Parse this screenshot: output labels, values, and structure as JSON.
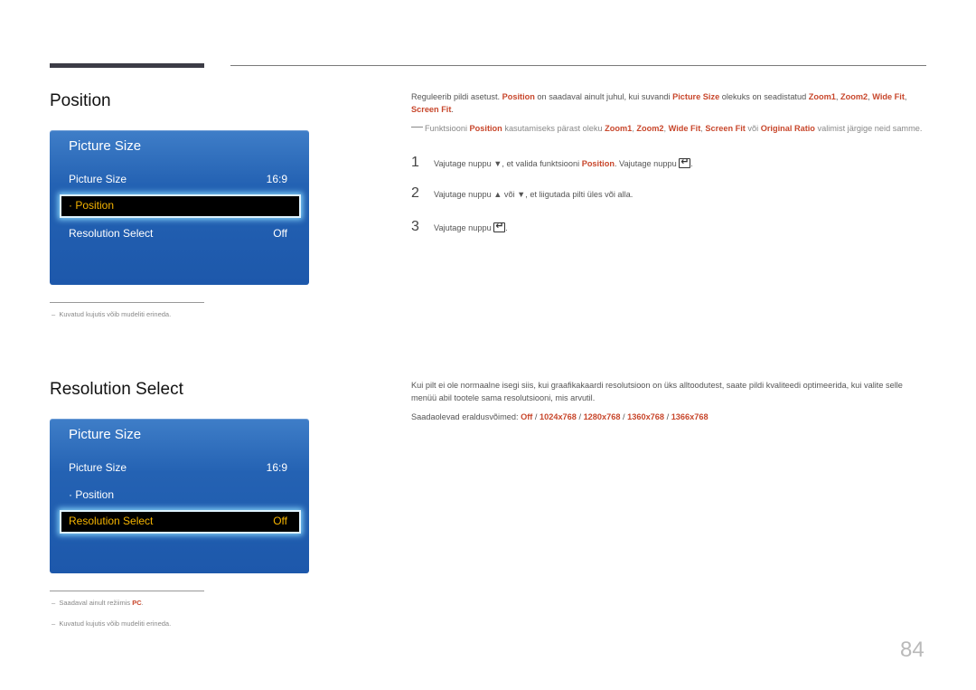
{
  "page_number": "84",
  "sections": {
    "position": {
      "title": "Position",
      "osd": {
        "title": "Picture Size",
        "rows": [
          {
            "label": "Picture Size",
            "value": "16:9"
          },
          {
            "label": "· Position",
            "value": ""
          },
          {
            "label": "Resolution Select",
            "value": "Off"
          }
        ],
        "selected_index": 1
      },
      "notes": [
        "Kuvatud kujutis võib mudeliti erineda."
      ],
      "description": {
        "p1_a": "Reguleerib pildi asetust. ",
        "p1_b": "Position",
        "p1_c": " on saadaval ainult juhul, kui suvandi ",
        "p1_d": "Picture Size",
        "p1_e": " olekuks on seadistatud ",
        "p1_f": "Zoom1",
        "p1_g": ", ",
        "p1_h": "Zoom2",
        "p1_i": ", ",
        "p1_j": "Wide Fit",
        "p1_k": ", ",
        "p1_l": "Screen Fit",
        "p1_m": "."
      },
      "note": {
        "a": "Funktsiooni ",
        "b": "Position",
        "c": " kasutamiseks pärast oleku ",
        "d": "Zoom1",
        "e": ", ",
        "f": "Zoom2",
        "g": ", ",
        "h": "Wide Fit",
        "i": ", ",
        "j": "Screen Fit",
        "k": " või ",
        "l": "Original Ratio",
        "m": " valimist järgige neid samme."
      },
      "steps": [
        {
          "num": "1",
          "a": "Vajutage nuppu ▼, et valida funktsiooni ",
          "b": "Position",
          "c": ". Vajutage nuppu ",
          "icon": "enter-icon",
          "d": "."
        },
        {
          "num": "2",
          "a": "Vajutage nuppu ▲ või ▼, et liigutada pilti üles või alla."
        },
        {
          "num": "3",
          "a": "Vajutage nuppu ",
          "icon": "enter-icon",
          "d": "."
        }
      ]
    },
    "resolution": {
      "title": "Resolution Select",
      "osd": {
        "title": "Picture Size",
        "rows": [
          {
            "label": "Picture Size",
            "value": "16:9"
          },
          {
            "label": "· Position",
            "value": ""
          },
          {
            "label": "Resolution Select",
            "value": "Off"
          }
        ],
        "selected_index": 2
      },
      "notes": [
        {
          "a": "Saadaval ainult režiimis ",
          "b": "PC",
          "c": "."
        },
        {
          "a": "Kuvatud kujutis võib mudeliti erineda."
        }
      ],
      "description": "Kui pilt ei ole normaalne isegi siis, kui graafikakaardi resolutsioon on üks alltoodutest, saate pildi kvaliteedi optimeerida, kui valite selle menüü abil tootele sama resolutsiooni, mis arvutil.",
      "available_label": "Saadaolevad eraldusvõimed: ",
      "resolutions": [
        "Off",
        "1024x768",
        "1280x768",
        "1360x768",
        "1366x768"
      ],
      "separator": " / "
    }
  },
  "colors": {
    "highlight": "#c8472c",
    "osd_blue": "#2462b3",
    "osd_selected_text": "#f5b400"
  }
}
